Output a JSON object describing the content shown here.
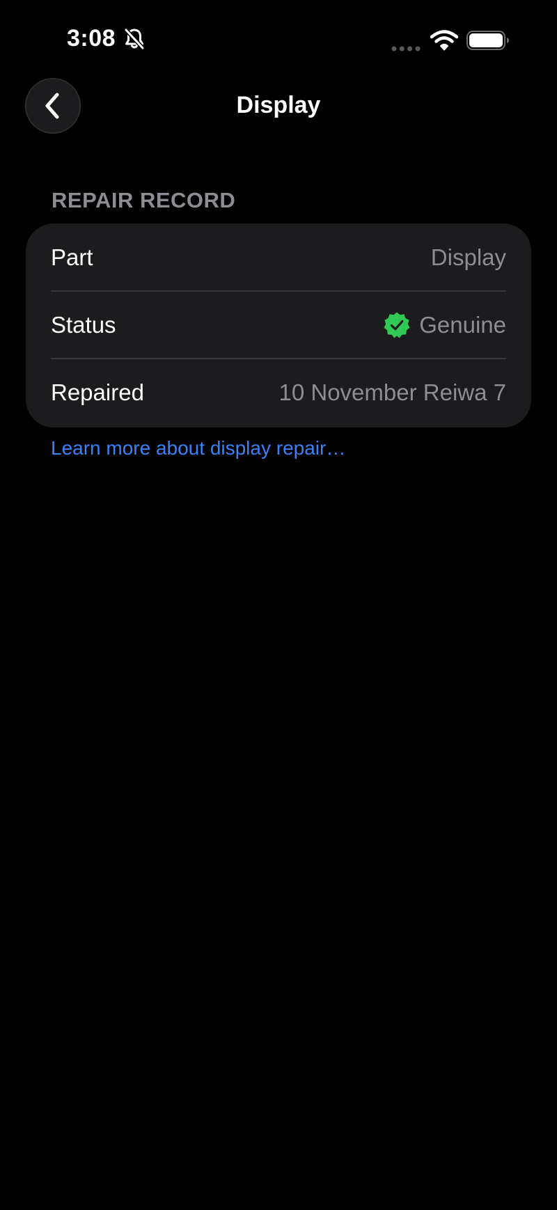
{
  "status_bar": {
    "time": "3:08",
    "icons": [
      "bell-off-icon",
      "cellular-dots-icon",
      "wifi-icon",
      "battery-icon"
    ]
  },
  "nav": {
    "back_icon": "chevron-left-icon",
    "title": "Display"
  },
  "section": {
    "header": "REPAIR RECORD",
    "rows": [
      {
        "label": "Part",
        "value": "Display"
      },
      {
        "label": "Status",
        "value": "Genuine",
        "icon": "verified-badge-icon"
      },
      {
        "label": "Repaired",
        "value": "10 November Reiwa 7"
      }
    ]
  },
  "link": {
    "text": "Learn more about display repair…"
  },
  "colors": {
    "background": "#000000",
    "card": "#1c1c1e",
    "secondary_text": "#8d8d93",
    "link": "#3a82f6",
    "verified_green": "#30c954"
  }
}
